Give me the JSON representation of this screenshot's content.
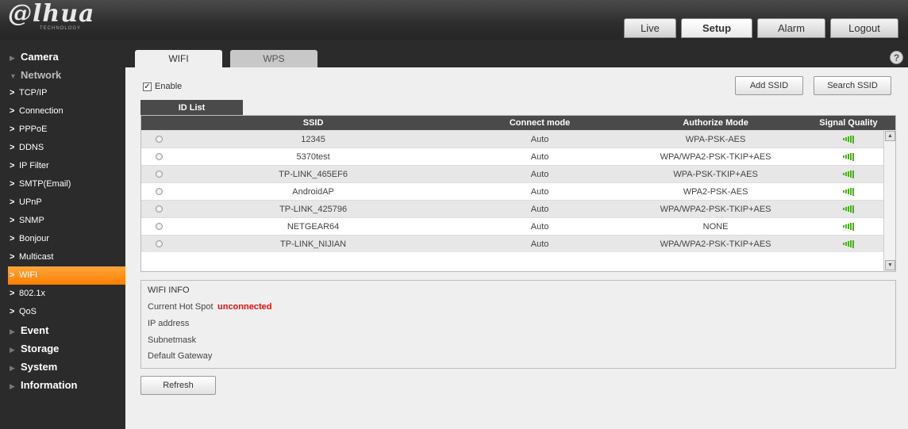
{
  "brand": {
    "logo": "@lhua",
    "sub": "TECHNOLOGY"
  },
  "topnav": {
    "live": "Live",
    "setup": "Setup",
    "alarm": "Alarm",
    "logout": "Logout"
  },
  "sidebar": {
    "camera": "Camera",
    "network": "Network",
    "items": [
      "TCP/IP",
      "Connection",
      "PPPoE",
      "DDNS",
      "IP Filter",
      "SMTP(Email)",
      "UPnP",
      "SNMP",
      "Bonjour",
      "Multicast",
      "WIFI",
      "802.1x",
      "QoS"
    ],
    "event": "Event",
    "storage": "Storage",
    "system": "System",
    "information": "Information"
  },
  "tabs": {
    "wifi": "WIFI",
    "wps": "WPS"
  },
  "enable": {
    "label": "Enable",
    "checked": true
  },
  "buttons": {
    "add_ssid": "Add SSID",
    "search_ssid": "Search SSID",
    "refresh": "Refresh"
  },
  "id_list": {
    "tab": "ID List",
    "columns": [
      "SSID",
      "Connect mode",
      "Authorize Mode",
      "Signal Quality"
    ],
    "rows": [
      {
        "ssid": "12345",
        "mode": "Auto",
        "auth": "WPA-PSK-AES"
      },
      {
        "ssid": "5370test",
        "mode": "Auto",
        "auth": "WPA/WPA2-PSK-TKIP+AES"
      },
      {
        "ssid": "TP-LINK_465EF6",
        "mode": "Auto",
        "auth": "WPA-PSK-TKIP+AES"
      },
      {
        "ssid": "AndroidAP",
        "mode": "Auto",
        "auth": "WPA2-PSK-AES"
      },
      {
        "ssid": "TP-LINK_425796",
        "mode": "Auto",
        "auth": "WPA/WPA2-PSK-TKIP+AES"
      },
      {
        "ssid": "NETGEAR64",
        "mode": "Auto",
        "auth": "NONE"
      },
      {
        "ssid": "TP-LINK_NIJIAN",
        "mode": "Auto",
        "auth": "WPA/WPA2-PSK-TKIP+AES"
      }
    ]
  },
  "wifi_info": {
    "title": "WIFI INFO",
    "hotspot_label": "Current Hot Spot",
    "hotspot_value": "unconnected",
    "ip_label": "IP address",
    "subnet_label": "Subnetmask",
    "gateway_label": "Default Gateway"
  },
  "help": "?",
  "colors": {
    "accent": "#ff8c1a",
    "status_red": "#e01010",
    "signal_green": "#4caf20"
  }
}
